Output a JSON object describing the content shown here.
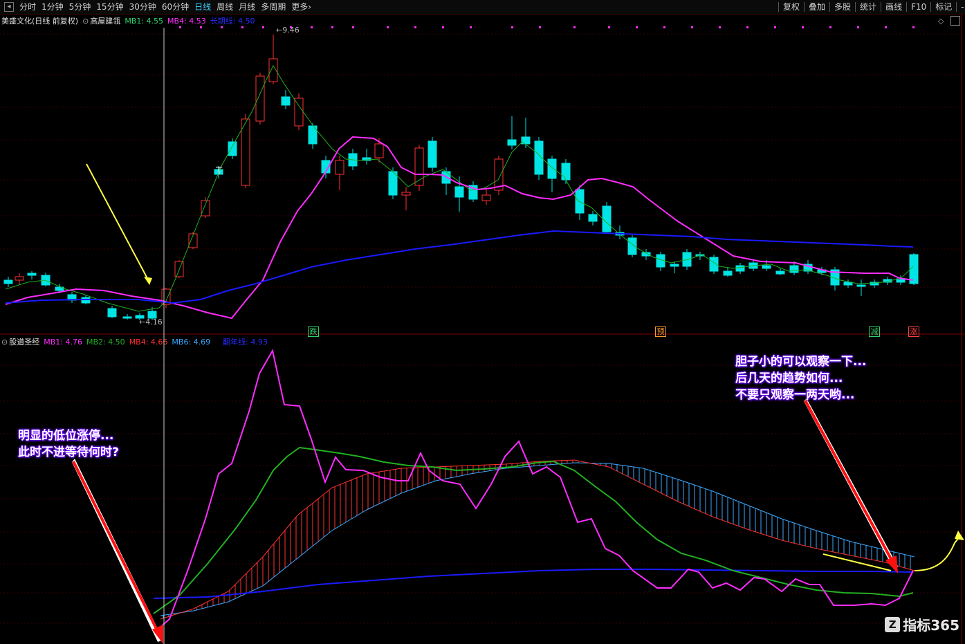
{
  "toolbar": {
    "periods": [
      "分时",
      "1分钟",
      "5分钟",
      "15分钟",
      "30分钟",
      "60分钟",
      "日线",
      "周线",
      "月线",
      "多周期",
      "更多"
    ],
    "active_period": "日线",
    "more_arrow": "›",
    "right_items": [
      "复权",
      "叠加",
      "多股",
      "统计",
      "画线",
      "F10",
      "标记",
      "-自选"
    ]
  },
  "main_legend": {
    "title": "美盛文化(日线 前复权)",
    "indicator_name": "高屋建瓴",
    "mb1": "MB1: 4.55",
    "mb4": "MB4: 4.53",
    "long": "长期线: 4.50"
  },
  "sub_legend": {
    "indicator_name": "股道圣经",
    "mb1": "MB1: 4.76",
    "mb2": "MB2: 4.50",
    "mb4": "MB4: 4.66",
    "mb6": "MB6: 4.69",
    "fan": "翻年线: 4.93"
  },
  "price_labels": {
    "high": "9.46",
    "low": "4.16"
  },
  "signals": [
    {
      "label": "跌",
      "color": "#2fd06a"
    },
    {
      "label": "预",
      "color": "#ff9a30"
    },
    {
      "label": "减",
      "color": "#2fd06a"
    },
    {
      "label": "涨",
      "color": "#ff4040"
    }
  ],
  "notes": {
    "left": [
      "明显的低位涨停...",
      "此时不进等待何时?"
    ],
    "right": [
      "胆子小的可以观察一下...",
      "后几天的趋势如何...",
      "不要只观察一两天哟..."
    ]
  },
  "watermark": {
    "logo": "Z",
    "text": "指标365"
  },
  "colors": {
    "up": "#ff3232",
    "down": "#00e4e4",
    "magenta": "#ff2dff",
    "blue": "#1a1aff",
    "green": "#22b022",
    "lightblue": "#3aa8ff",
    "yellow": "#ffff40"
  },
  "chart_data": [
    {
      "type": "candlestick",
      "title": "美盛文化(日线 前复权)",
      "series": [
        {
          "name": "MB1",
          "last": 4.55
        },
        {
          "name": "MB4",
          "last": 4.53
        },
        {
          "name": "长期线",
          "last": 4.5
        }
      ],
      "annotations": {
        "high": 9.46,
        "low": 4.16
      }
    },
    {
      "type": "line",
      "title": "股道圣经",
      "series": [
        {
          "name": "MB1",
          "last": 4.76
        },
        {
          "name": "MB2",
          "last": 4.5
        },
        {
          "name": "MB4",
          "last": 4.66
        },
        {
          "name": "MB6",
          "last": 4.69
        },
        {
          "name": "翻年线",
          "last": 4.93
        }
      ]
    }
  ]
}
